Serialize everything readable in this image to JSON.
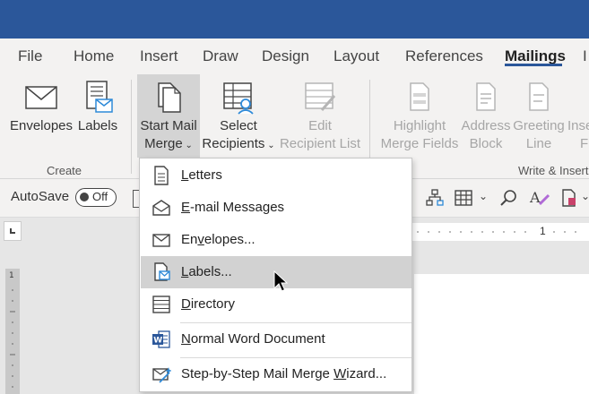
{
  "tabs": [
    {
      "label": "File",
      "active": false
    },
    {
      "label": "Home",
      "active": false
    },
    {
      "label": "Insert",
      "active": false
    },
    {
      "label": "Draw",
      "active": false
    },
    {
      "label": "Design",
      "active": false
    },
    {
      "label": "Layout",
      "active": false
    },
    {
      "label": "References",
      "active": false
    },
    {
      "label": "Mailings",
      "active": true
    },
    {
      "label": "I",
      "active": false
    }
  ],
  "ribbon": {
    "create_group": "Create",
    "write_group": "Write & Insert",
    "envelopes": "Envelopes",
    "labels": "Labels",
    "start_mail_merge": [
      "Start Mail",
      "Merge"
    ],
    "select_recipients": [
      "Select",
      "Recipients"
    ],
    "edit_recipient_list": [
      "Edit",
      "Recipient List"
    ],
    "highlight_merge_fields": [
      "Highlight",
      "Merge Fields"
    ],
    "address_block": [
      "Address",
      "Block"
    ],
    "greeting_line": [
      "Greeting",
      "Line"
    ],
    "insert_merge_field": [
      "Inse",
      "F"
    ]
  },
  "qat": {
    "autosave_label": "AutoSave",
    "toggle_state": "Off"
  },
  "ruler": {
    "mark": "1"
  },
  "menu": {
    "items": [
      {
        "label": "Letters",
        "icon": "letter-icon"
      },
      {
        "label": "E-mail Messages",
        "icon": "email-icon"
      },
      {
        "label": "Envelopes...",
        "icon": "envelope-icon"
      },
      {
        "label": "Labels...",
        "icon": "labels-icon"
      },
      {
        "label": "Directory",
        "icon": "directory-icon"
      },
      {
        "label": "Normal Word Document",
        "icon": "word-document-icon"
      },
      {
        "label": "Step-by-Step Mail Merge Wizard...",
        "icon": "wizard-icon"
      }
    ],
    "hovered_index": 3
  },
  "colors": {
    "title_bar": "#2b579a",
    "ribbon_bg": "#f3f2f1",
    "menu_hover": "#d2d2d2",
    "accent_blue": "#2e8ad8"
  }
}
